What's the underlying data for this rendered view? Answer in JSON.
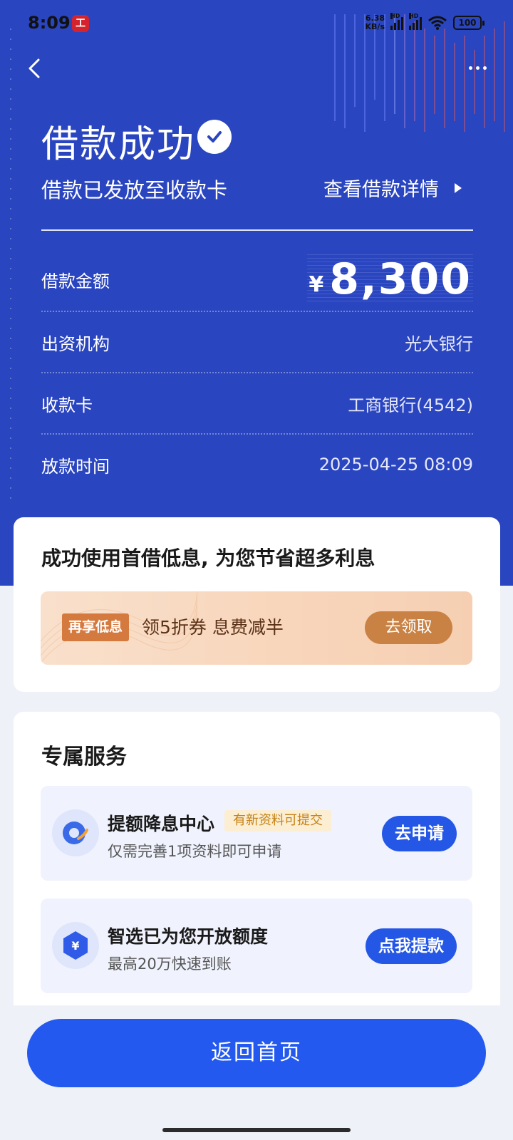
{
  "status_bar": {
    "time": "8:09",
    "app_icon_glyph": "工",
    "net_speed_value": "6.38",
    "net_speed_unit": "KB/s",
    "signal_label": "HD",
    "battery": "100"
  },
  "header": {
    "title": "借款成功",
    "subtitle": "借款已发放至收款卡",
    "detail_link": "查看借款详情"
  },
  "loan": {
    "amount_label": "借款金额",
    "currency_symbol": "¥",
    "amount": "8,300",
    "lender_label": "出资机构",
    "lender": "光大银行",
    "card_label": "收款卡",
    "card": "工商银行(4542)",
    "time_label": "放款时间",
    "time": "2025-04-25 08:09"
  },
  "promo": {
    "title": "成功使用首借低息, 为您节省超多利息",
    "tag": "再享低息",
    "text": "领5折券  息费减半",
    "button": "去领取"
  },
  "services": {
    "title": "专属服务",
    "items": [
      {
        "title": "提额降息中心",
        "badge": "有新资料可提交",
        "subtitle": "仅需完善1项资料即可申请",
        "button": "去申请",
        "icon": "credit-boost-icon"
      },
      {
        "title": "智选已为您开放额度",
        "subtitle": "最高20万快速到账",
        "button": "点我提款",
        "icon": "yuan-shield-icon"
      }
    ]
  },
  "footer": {
    "home_button": "返回首页"
  },
  "colors": {
    "hero_blue": "#2a45c0",
    "primary_button": "#2359ee",
    "coupon_button": "#c98243",
    "badge_text": "#c68318"
  }
}
